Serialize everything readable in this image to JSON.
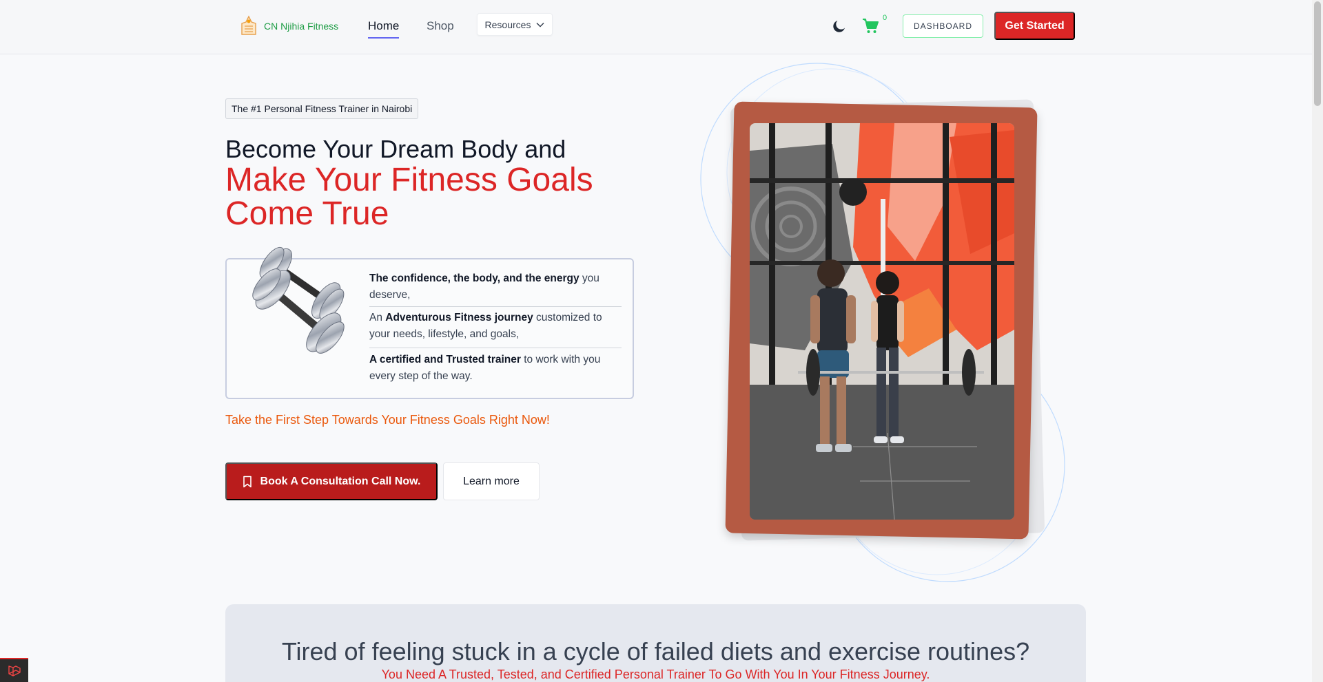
{
  "nav": {
    "brand_name": "CN Njihia Fitness",
    "links": [
      {
        "label": "Home"
      },
      {
        "label": "Shop"
      }
    ],
    "resources_label": "Resources",
    "cart_count": "0",
    "dashboard_label": "DASHBOARD",
    "get_started_label": "Get Started",
    "accent_color": "#dc2626"
  },
  "hero": {
    "badge": "The #1 Personal Fitness Trainer in Nairobi",
    "headline_line1": "Become Your Dream Body and",
    "headline_line2": "Make Your Fitness Goals Come True",
    "features": [
      {
        "bold": "The confidence, the body, and the energy",
        "rest": " you deserve,"
      },
      {
        "prefix": "An ",
        "bold": "Adventurous Fitness journey",
        "rest": " customized to your needs, lifestyle, and goals,"
      },
      {
        "bold": "A certified and Trusted trainer",
        "rest": " to work with you every step of the way."
      }
    ],
    "cta_text": "Take the First Step Towards Your Fitness Goals Right Now!",
    "primary_button": "Book A Consultation Call Now.",
    "secondary_button": "Learn more"
  },
  "problem": {
    "title": "Tired of feeling stuck in a cycle of failed diets and exercise routines?",
    "subtitle": "You Need A Trusted, Tested, and Certified Personal Trainer To Go With You In Your Fitness Journey."
  },
  "icons": [
    "brand-logo-icon",
    "chevron-down-icon",
    "moon-icon",
    "cart-icon",
    "bookmark-icon",
    "dumbbells-image",
    "gym-photo",
    "laravel-icon"
  ]
}
